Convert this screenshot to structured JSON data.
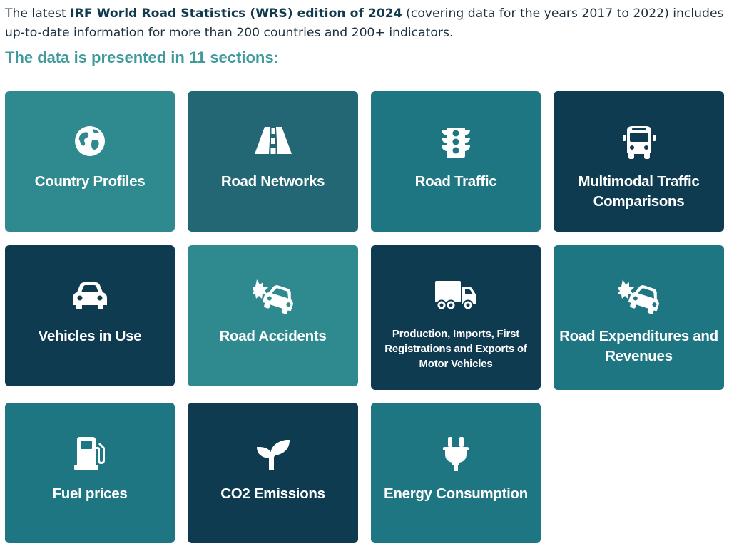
{
  "intro": {
    "pre": "The latest ",
    "bold": "IRF World Road Statistics (WRS) edition of 2024",
    "post": " (covering data for the years 2017 to 2022) includes up-to-date information for more than 200 countries and 200+ indicators."
  },
  "heading": "The data is presented in 11 sections:",
  "colors": {
    "teal": "#2e8a8e",
    "slate_teal": "#236674",
    "mid_teal": "#1f7683",
    "navy": "#0e3b50",
    "heading": "#3f9a9c"
  },
  "tiles": [
    {
      "label": "Country Profiles",
      "icon": "globe-icon"
    },
    {
      "label": "Road Networks",
      "icon": "road-icon"
    },
    {
      "label": "Road Traffic",
      "icon": "traffic-light-icon"
    },
    {
      "label": "Multimodal Traffic Comparisons",
      "icon": "bus-icon"
    },
    {
      "label": "Vehicles in Use",
      "icon": "car-icon"
    },
    {
      "label": "Road Accidents",
      "icon": "car-crash-icon"
    },
    {
      "label": "Production, Imports, First Registrations and Exports of Motor Vehicles",
      "icon": "truck-icon"
    },
    {
      "label": "Road Expenditures and Revenues",
      "icon": "car-crash-icon"
    },
    {
      "label": "Fuel prices",
      "icon": "gas-pump-icon"
    },
    {
      "label": "CO2 Emissions",
      "icon": "seedling-icon"
    },
    {
      "label": "Energy Consumption",
      "icon": "plug-icon"
    }
  ]
}
